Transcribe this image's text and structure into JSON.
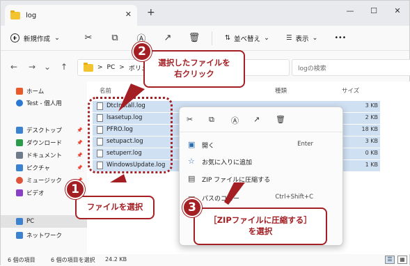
{
  "window": {
    "tab_title": "log",
    "new_tab": "+",
    "minimize": "—",
    "maximize": "☐",
    "close": "✕"
  },
  "toolbar": {
    "new_label": "新規作成",
    "sort_label": "並べ替え",
    "view_label": "表示",
    "more": "•••"
  },
  "address": {
    "path_pc": "PC",
    "path_sep": ">",
    "path_rest": "ボリュー",
    "search_placeholder": "logの検索"
  },
  "sidebar": {
    "items": [
      {
        "label": "ホーム",
        "icon": "home-icon",
        "color": "#e85a2a"
      },
      {
        "label": "Test - 個人用",
        "icon": "cloud-icon",
        "color": "#2b79d3"
      },
      {
        "label": "デスクトップ",
        "icon": "desktop-icon",
        "color": "#3b82d1"
      },
      {
        "label": "ダウンロード",
        "icon": "download-icon",
        "color": "#2a9d4a"
      },
      {
        "label": "ドキュメント",
        "icon": "document-icon",
        "color": "#6e7b8b"
      },
      {
        "label": "ピクチャ",
        "icon": "pictures-icon",
        "color": "#3b82d1"
      },
      {
        "label": "ミュージック",
        "icon": "music-icon",
        "color": "#e0533a"
      },
      {
        "label": "ビデオ",
        "icon": "video-icon",
        "color": "#8a3fc7"
      },
      {
        "label": "PC",
        "icon": "pc-icon",
        "color": "#3b82d1"
      },
      {
        "label": "ネットワーク",
        "icon": "network-icon",
        "color": "#3b82d1"
      }
    ]
  },
  "columns": {
    "name": "名前",
    "type": "種類",
    "size": "サイズ"
  },
  "files": [
    {
      "name": "DtcInstall.log",
      "size": "3 KB"
    },
    {
      "name": "lsasetup.log",
      "size": "2 KB"
    },
    {
      "name": "PFRO.log",
      "size": "18 KB"
    },
    {
      "name": "setupact.log",
      "size": "3 KB"
    },
    {
      "name": "setuperr.log",
      "size": "0 KB"
    },
    {
      "name": "WindowsUpdate.log",
      "size": "1 KB"
    }
  ],
  "context_menu": {
    "items": [
      {
        "label": "開く",
        "shortcut": "Enter",
        "icon": "open-icon"
      },
      {
        "label": "お気に入りに追加",
        "shortcut": "",
        "icon": "star-icon"
      },
      {
        "label": "ZIP ファイルに圧縮する",
        "shortcut": "",
        "icon": "zip-icon"
      },
      {
        "label": "パスのコピー",
        "shortcut": "Ctrl+Shift+C",
        "icon": "path-icon"
      }
    ]
  },
  "status": {
    "items_count": "6 個の項目",
    "selected": "6 個の項目を選択",
    "selected_size": "24.2 KB"
  },
  "annotations": {
    "step1_num": "1",
    "step1_text": "ファイルを選択",
    "step2_num": "2",
    "step2_text_line1": "選択したファイルを",
    "step2_text_line2": "右クリック",
    "step3_num": "3",
    "step3_text_line1": "［ZIPファイルに圧縮する］",
    "step3_text_line2": "を選択",
    "accent_color": "#a31f23"
  }
}
